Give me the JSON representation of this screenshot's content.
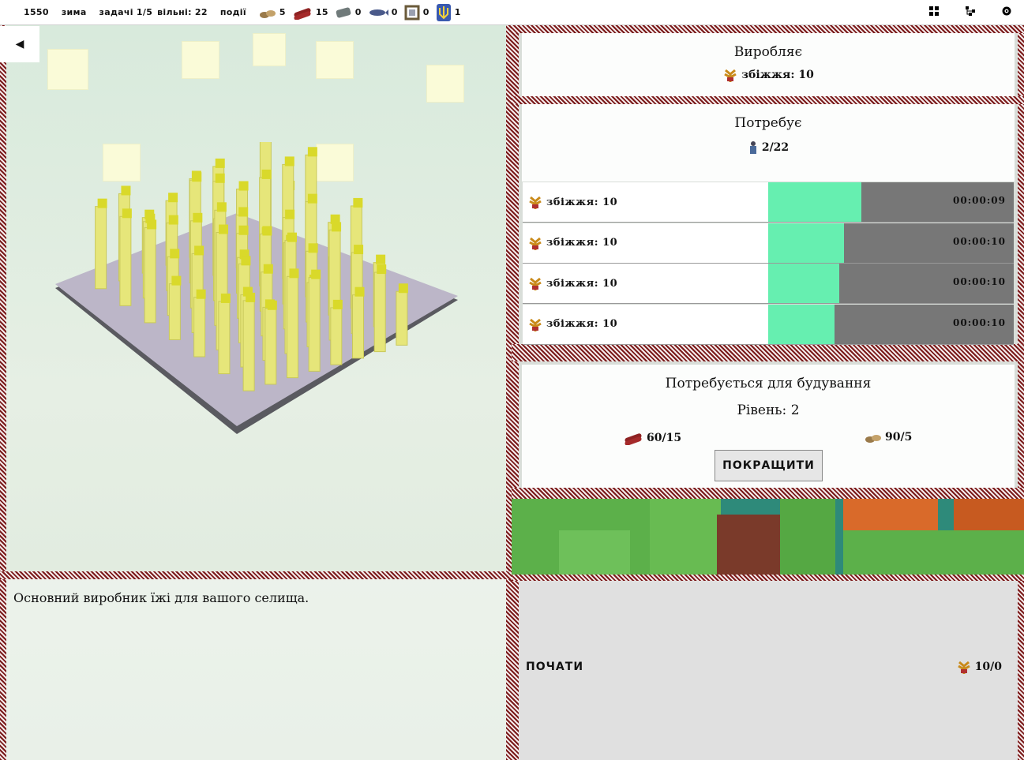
{
  "topbar": {
    "year": "1550",
    "season": "зима",
    "tasks": "задачі 1/5",
    "free": "вільні: 22",
    "events": "події",
    "resources": [
      {
        "icon": "food-sacks-icon",
        "value": "5"
      },
      {
        "icon": "wood-logs-icon",
        "value": "15"
      },
      {
        "icon": "stone-icon",
        "value": "0"
      },
      {
        "icon": "fish-icon",
        "value": "0"
      },
      {
        "icon": "frame-icon",
        "value": "0"
      },
      {
        "icon": "trident-icon",
        "value": "1"
      }
    ]
  },
  "produces": {
    "title": "Виробляє",
    "item": "збіжжя: 10"
  },
  "needs": {
    "title": "Потребує",
    "workers": "2/22"
  },
  "queue": [
    {
      "label": "збіжжя: 10",
      "progress": 0.38,
      "time": "00:00:09"
    },
    {
      "label": "збіжжя: 10",
      "progress": 0.31,
      "time": "00:00:10"
    },
    {
      "label": "збіжжя: 10",
      "progress": 0.29,
      "time": "00:00:10"
    },
    {
      "label": "збіжжя: 10",
      "progress": 0.27,
      "time": "00:00:10"
    }
  ],
  "build": {
    "title": "Потребується для будування",
    "level": "Рівень: 2",
    "wood": "60/15",
    "food": "90/5",
    "upgrade_label": "ПОКРАЩИТИ"
  },
  "description": "Основний виробник їжі для вашого селища.",
  "start": {
    "label": "ПОЧАТИ",
    "amount": "10/0"
  },
  "colors": {
    "progress": "#66efb0",
    "ornament": "#7a1a1a",
    "wheat": "#e6e67a"
  }
}
